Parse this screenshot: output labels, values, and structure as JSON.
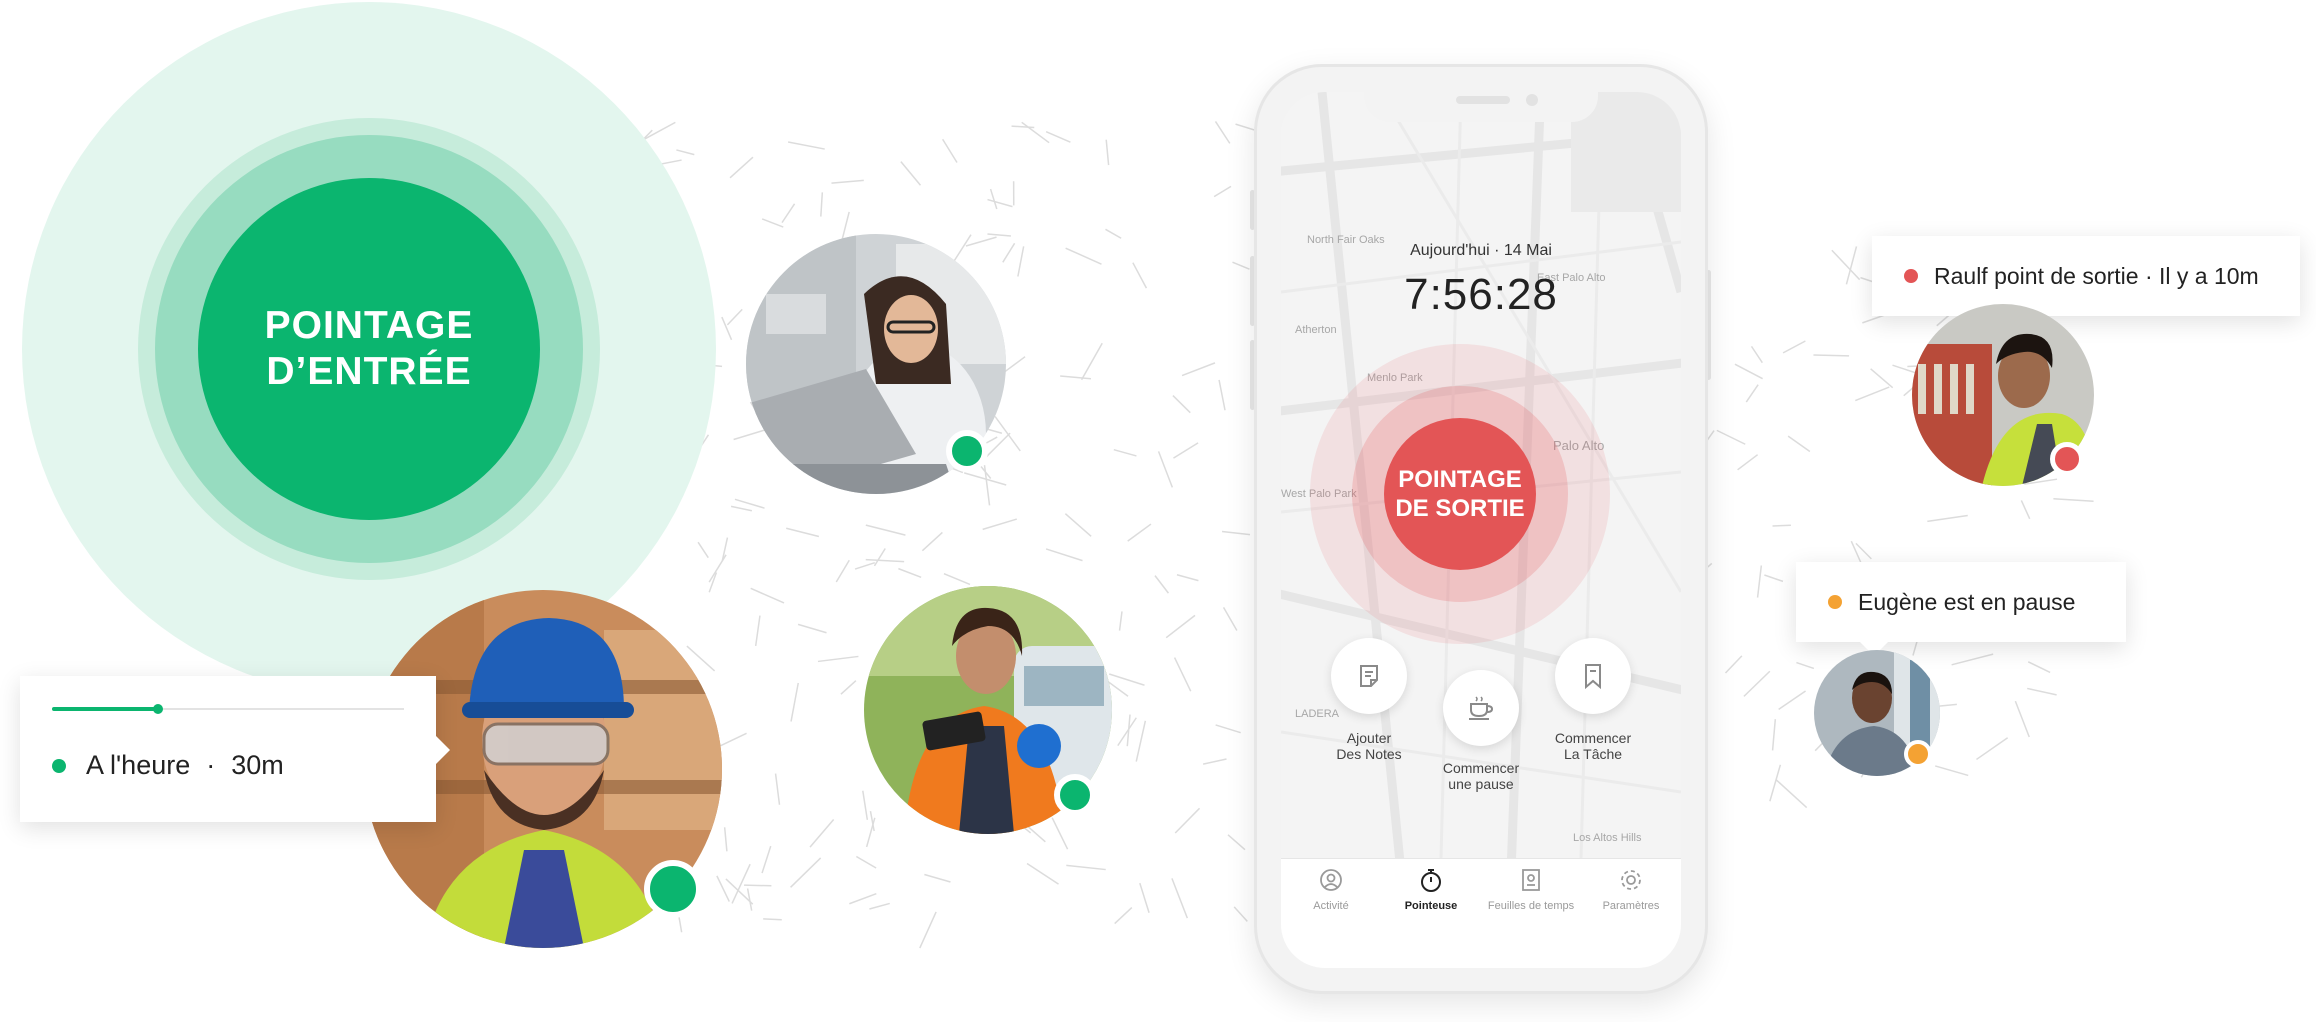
{
  "clock_in": {
    "line1": "POINTAGE",
    "line2": "D’ENTRÉE"
  },
  "status_card_left": {
    "status": "A l'heure",
    "separator": "·",
    "duration": "30m",
    "progress": 0.3,
    "dot_color": "#0bb56f"
  },
  "notifications": [
    {
      "text": "Raulf point de sortie · Il y a 10m",
      "dot_color": "#e35556"
    },
    {
      "text": "Eugène est en pause",
      "dot_color": "#f4a233"
    }
  ],
  "phone": {
    "date": "Aujourd'hui · 14 Mai",
    "time": "7:56:28",
    "clock_out": {
      "line1": "POINTAGE",
      "line2": "DE SORTIE"
    },
    "actions": [
      {
        "line1": "Ajouter",
        "line2": "Des Notes",
        "icon": "notes-icon"
      },
      {
        "line1": "Commencer",
        "line2": "une pause",
        "icon": "coffee-icon"
      },
      {
        "line1": "Commencer",
        "line2": "La Tâche",
        "icon": "bookmark-icon"
      }
    ],
    "tabs": [
      {
        "label": "Activité",
        "icon": "activity-icon",
        "active": false
      },
      {
        "label": "Pointeuse",
        "icon": "stopwatch-icon",
        "active": true
      },
      {
        "label": "Feuilles de temps",
        "icon": "timesheet-icon",
        "active": false
      },
      {
        "label": "Paramètres",
        "icon": "gear-icon",
        "active": false
      }
    ],
    "map_labels": [
      "North Fair Oaks",
      "East Palo Alto",
      "Atherton",
      "Menlo Park",
      "Palo Alto",
      "West Palo Park",
      "LADERA",
      "Los Altos Hills"
    ]
  },
  "status_colors": {
    "active": "#0bb56f",
    "out": "#e35556",
    "pause": "#f4a233"
  }
}
